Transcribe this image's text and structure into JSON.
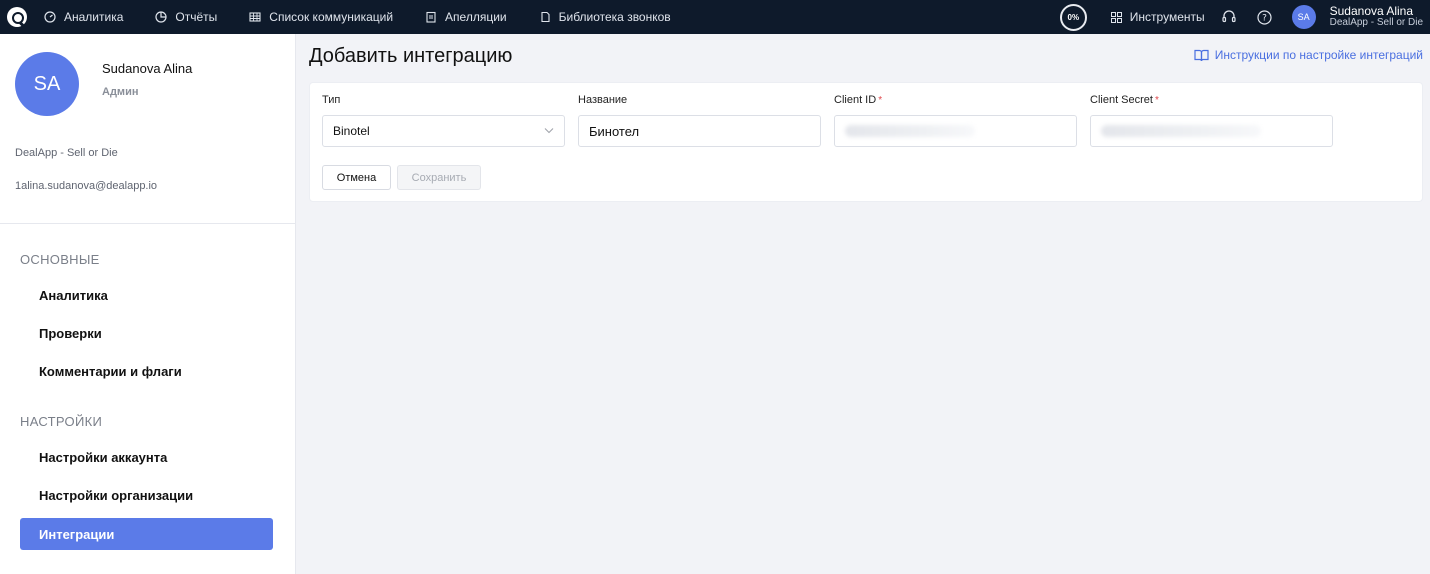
{
  "topbar": {
    "nav": [
      {
        "label": "Аналитика",
        "icon": "dashboard-icon"
      },
      {
        "label": "Отчёты",
        "icon": "pie-chart-icon"
      },
      {
        "label": "Список коммуникаций",
        "icon": "table-icon"
      },
      {
        "label": "Апелляции",
        "icon": "clipboard-icon"
      },
      {
        "label": "Библиотека звонков",
        "icon": "book-icon"
      }
    ],
    "progress": "0%",
    "tools_label": "Инструменты",
    "user_initials": "SA",
    "user_name": "Sudanova Alina",
    "user_org": "DealApp - Sell or Die"
  },
  "sidebar": {
    "initials": "SA",
    "name": "Sudanova Alina",
    "role": "Админ",
    "org": "DealApp - Sell or Die",
    "email": "1alina.sudanova@dealapp.io",
    "section_main": "ОСНОВНЫЕ",
    "main_items": [
      "Аналитика",
      "Проверки",
      "Комментарии и флаги"
    ],
    "section_settings": "НАСТРОЙКИ",
    "settings_items": [
      "Настройки аккаунта",
      "Настройки организации",
      "Интеграции"
    ]
  },
  "main": {
    "title": "Добавить интеграцию",
    "help_link": "Инструкции по настройке интеграций",
    "form": {
      "type_label": "Тип",
      "type_value": "Binotel",
      "name_label": "Название",
      "name_value": "Бинотел",
      "client_id_label": "Client ID",
      "client_secret_label": "Client Secret",
      "required_mark": "*"
    },
    "cancel_label": "Отмена",
    "save_label": "Сохранить"
  },
  "colors": {
    "topbar": "#0e1a2b",
    "accent": "#5b7be8",
    "link": "#4a6fe0",
    "required": "#e0474c"
  }
}
